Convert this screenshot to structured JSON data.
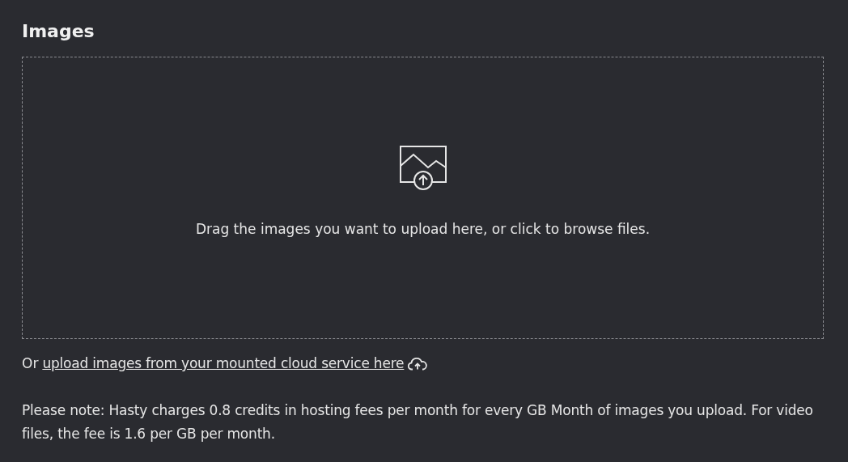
{
  "title": "Images",
  "dropzone": {
    "instruction": "Drag the images you want to upload here, or click to browse files."
  },
  "cloud_upload": {
    "prefix": "Or",
    "link": "upload images from your mounted cloud service here"
  },
  "note": "Please note: Hasty charges 0.8 credits in hosting fees per month for every GB Month of images you upload. For video files, the fee is 1.6 per GB per month."
}
